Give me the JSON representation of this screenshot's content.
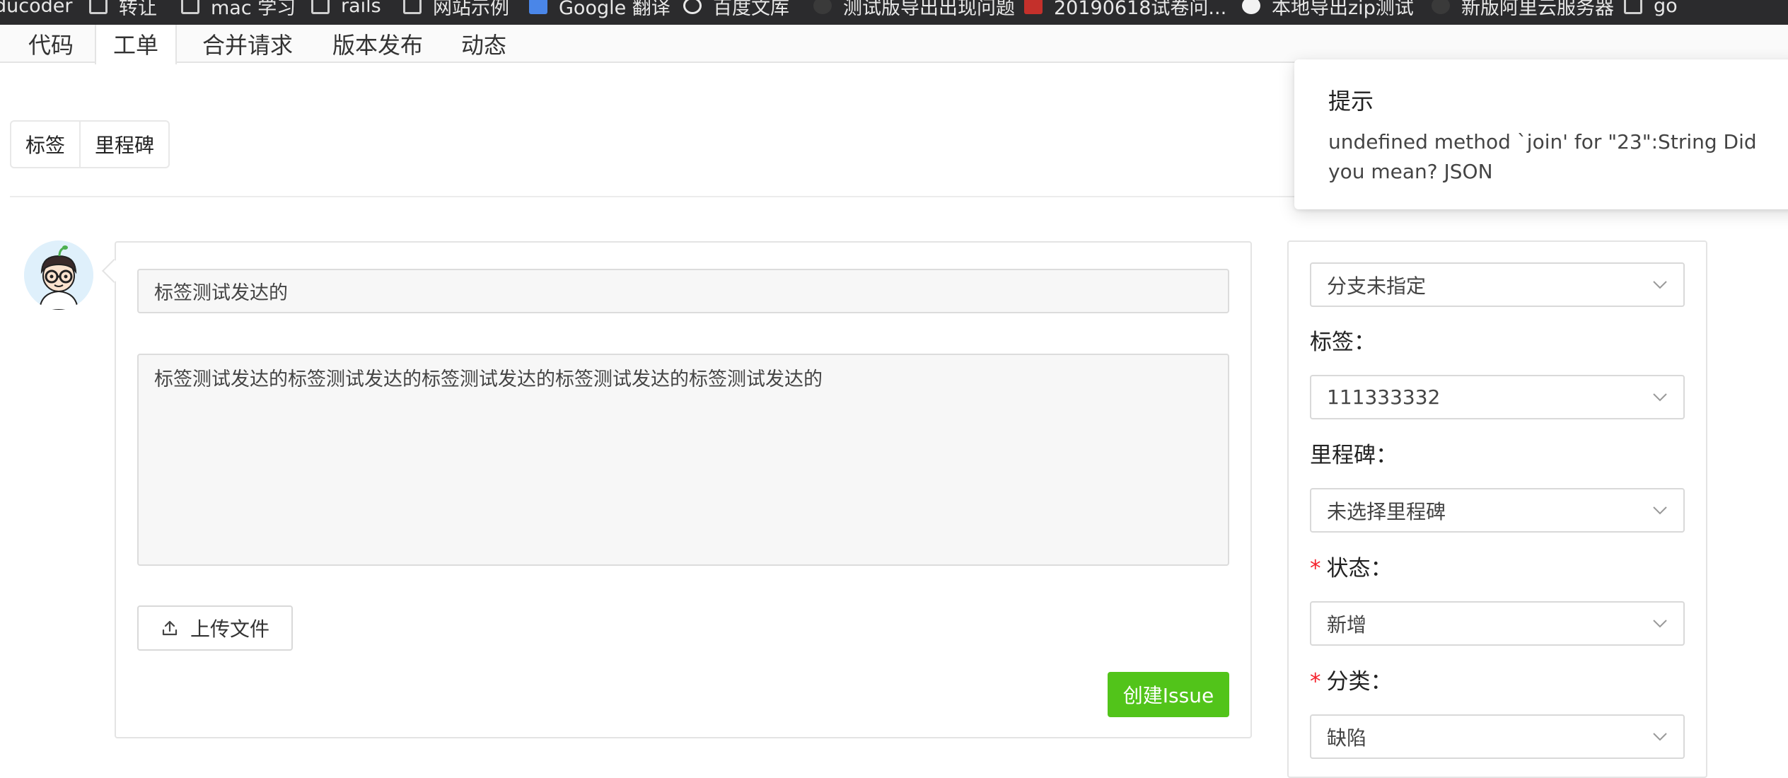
{
  "bookmarks": [
    {
      "label": "ducoder",
      "icon": "none"
    },
    {
      "label": "转让",
      "icon": "folder-icon"
    },
    {
      "label": "mac 学习",
      "icon": "folder-icon"
    },
    {
      "label": "rails",
      "icon": "folder-icon"
    },
    {
      "label": "网站示例",
      "icon": "folder-icon"
    },
    {
      "label": "Google 翻译",
      "icon": "translate-icon"
    },
    {
      "label": "百度文库",
      "icon": "globe-icon"
    },
    {
      "label": "测试版导出出现问题",
      "icon": "site-icon"
    },
    {
      "label": "20190618试卷问...",
      "icon": "site-icon"
    },
    {
      "label": "本地导出zip测试",
      "icon": "github-icon"
    },
    {
      "label": "新版阿里云服务器",
      "icon": "site-icon"
    },
    {
      "label": "go",
      "icon": "folder-icon"
    }
  ],
  "tabs": [
    {
      "label": "代码"
    },
    {
      "label": "工单"
    },
    {
      "label": "合并请求"
    },
    {
      "label": "版本发布"
    },
    {
      "label": "动态"
    }
  ],
  "filters": {
    "labels_button": "标签",
    "milestones_button": "里程碑"
  },
  "form": {
    "title_value": "标签测试发达的",
    "description_value": "标签测试发达的标签测试发达的标签测试发达的标签测试发达的标签测试发达的",
    "upload_label": "上传文件",
    "submit_label": "创建Issue"
  },
  "sidebar": {
    "branch_value": "分支未指定",
    "tag_label": "标签：",
    "tag_value": "111333332",
    "milestone_label": "里程碑：",
    "milestone_value": "未选择里程碑",
    "status_label": "状态：",
    "status_value": "新增",
    "category_label": "分类：",
    "category_value": "缺陷",
    "required_mark": "*"
  },
  "notification": {
    "title": "提示",
    "message": "undefined method `join' for \"23\":String Did you mean? JSON"
  },
  "colors": {
    "primary_green": "#52c41a",
    "required_red": "#f5222d"
  }
}
